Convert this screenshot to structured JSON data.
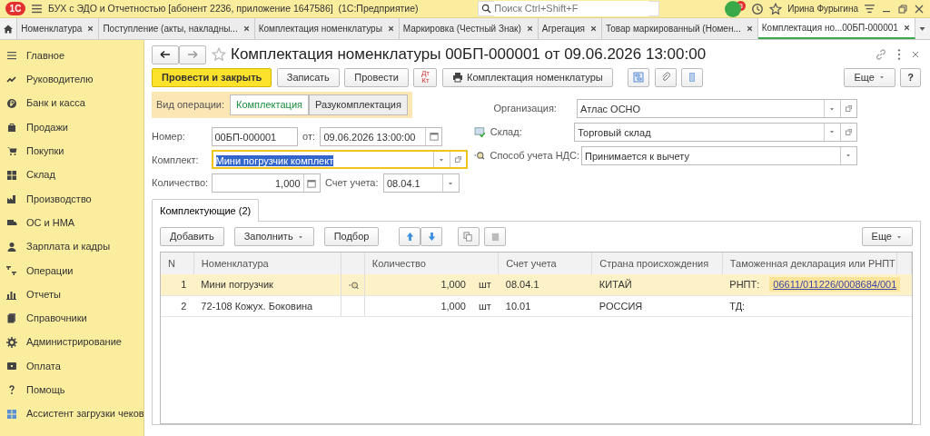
{
  "app_bar": {
    "logo": "1С",
    "title": "БУХ с ЭДО и Отчетностью [абонент 2236, приложение 1647586]  (1С:Предприятие)",
    "search": {
      "placeholder": "Поиск Ctrl+Shift+F"
    },
    "notifications": "3",
    "user": "Ирина Фурыгина"
  },
  "tabs": [
    {
      "label": "Номенклатура",
      "selected": false
    },
    {
      "label": "Поступление (акты, накладны...",
      "selected": false
    },
    {
      "label": "Комплектация номенклатуры",
      "selected": false
    },
    {
      "label": "Маркировка (Честный Знак)",
      "selected": false
    },
    {
      "label": "Агрегация",
      "selected": false
    },
    {
      "label": "Товар маркированный (Номен...",
      "selected": false
    },
    {
      "label": "Комплектация но...00БП-000001",
      "selected": true
    }
  ],
  "sidebar": {
    "items": [
      {
        "label": "Главное"
      },
      {
        "label": "Руководителю"
      },
      {
        "label": "Банк и касса"
      },
      {
        "label": "Продажи"
      },
      {
        "label": "Покупки"
      },
      {
        "label": "Склад"
      },
      {
        "label": "Производство"
      },
      {
        "label": "ОС и НМА"
      },
      {
        "label": "Зарплата и кадры"
      },
      {
        "label": "Операции"
      },
      {
        "label": "Отчеты"
      },
      {
        "label": "Справочники"
      },
      {
        "label": "Администрирование"
      },
      {
        "label": "Оплата"
      },
      {
        "label": "Помощь"
      },
      {
        "label": "Ассистент загрузки чеков"
      }
    ]
  },
  "form": {
    "title": "Комплектация номенклатуры 00БП-000001 от 09.06.2026 13:00:00",
    "dt_kt": "Дт Кт",
    "buttons": [
      {
        "label": "Провести и закрыть",
        "kind": "primary"
      },
      {
        "label": "Записать",
        "kind": "plain"
      },
      {
        "label": "Провести",
        "kind": "plain"
      },
      {
        "label": "Комплектация номенклатуры",
        "kind": "print"
      }
    ],
    "more": "Еще",
    "help": "?",
    "operation": {
      "label": "Вид операции:",
      "options": [
        {
          "label": "Комплектация",
          "selected": true
        },
        {
          "label": "Разукомплектация",
          "selected": false
        }
      ]
    },
    "number": {
      "label": "Номер:",
      "value": "00БП-000001"
    },
    "date": {
      "label": "от:",
      "value": "09.06.2026 13:00:00"
    },
    "kit": {
      "label": "Комплект:",
      "value": "Мини погрузчик комплект",
      "focused": true
    },
    "quantity": {
      "label": "Количество:",
      "value": "1,000"
    },
    "account": {
      "label": "Счет учета:",
      "value": "08.04.1"
    },
    "organization": {
      "label": "Организация:",
      "value": "Атлас ОСНО"
    },
    "warehouse": {
      "label": "Склад:",
      "value": "Торговый склад"
    },
    "vat": {
      "label": "Способ учета НДС:",
      "value": "Принимается к вычету"
    },
    "section_tab": {
      "label": "Комплектующие (2)",
      "selected": true
    },
    "table_toolbar": {
      "buttons": [
        {
          "label": "Добавить"
        },
        {
          "label": "Заполнить",
          "dropdown": true
        },
        {
          "label": "Подбор"
        }
      ],
      "more": "Еще"
    },
    "table": {
      "columns": [
        "N",
        "Номенклатура",
        "Количество",
        "Счет учета",
        "Страна происхождения",
        "Таможенная декларация или РНПТ"
      ],
      "rows": [
        {
          "n": "1",
          "name": "Мини погрузчик",
          "traced": true,
          "quantity": "1,000",
          "unit": "шт",
          "account": "08.04.1",
          "country": "КИТАЙ",
          "decl_label": "РНПТ:",
          "decl_value": "06611/011226/0008684/001",
          "selected": true
        },
        {
          "n": "2",
          "name": "72-108 Кожух. Боковина",
          "traced": false,
          "quantity": "1,000",
          "unit": "шт",
          "account": "10.01",
          "country": "РОССИЯ",
          "decl_label": "ТД:",
          "selected": false
        }
      ]
    }
  }
}
